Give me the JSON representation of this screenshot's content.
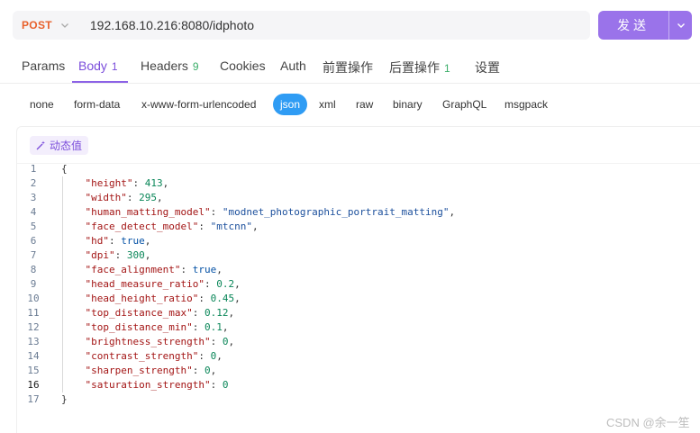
{
  "request": {
    "method": "POST",
    "url": "192.168.10.216:8080/idphoto",
    "send_label": "发送"
  },
  "tabs": [
    {
      "label": "Params",
      "badge": ""
    },
    {
      "label": "Body",
      "badge": "1"
    },
    {
      "label": "Headers",
      "badge": "9"
    },
    {
      "label": "Cookies",
      "badge": ""
    },
    {
      "label": "Auth",
      "badge": ""
    },
    {
      "label": "前置操作",
      "badge": ""
    },
    {
      "label": "后置操作",
      "badge": "1"
    },
    {
      "label": "设置",
      "badge": ""
    }
  ],
  "active_tab": "Body",
  "body_types": [
    "none",
    "form-data",
    "x-www-form-urlencoded",
    "json",
    "xml",
    "raw",
    "binary",
    "GraphQL",
    "msgpack"
  ],
  "active_body_type": "json",
  "dynamic_value_label": "动态值",
  "editor": {
    "line_numbers": [
      "1",
      "2",
      "3",
      "4",
      "5",
      "6",
      "7",
      "8",
      "9",
      "10",
      "11",
      "12",
      "13",
      "14",
      "15",
      "16",
      "17"
    ],
    "open_brace": "{",
    "close_brace": "}",
    "fields": [
      {
        "key": "\"height\"",
        "value": "413",
        "type": "number",
        "comma": ","
      },
      {
        "key": "\"width\"",
        "value": "295",
        "type": "number",
        "comma": ","
      },
      {
        "key": "\"human_matting_model\"",
        "value": "\"modnet_photographic_portrait_matting\"",
        "type": "string",
        "comma": ","
      },
      {
        "key": "\"face_detect_model\"",
        "value": "\"mtcnn\"",
        "type": "string",
        "comma": ","
      },
      {
        "key": "\"hd\"",
        "value": "true",
        "type": "bool",
        "comma": ","
      },
      {
        "key": "\"dpi\"",
        "value": "300",
        "type": "number",
        "comma": ","
      },
      {
        "key": "\"face_alignment\"",
        "value": "true",
        "type": "bool",
        "comma": ","
      },
      {
        "key": "\"head_measure_ratio\"",
        "value": "0.2",
        "type": "number",
        "comma": ","
      },
      {
        "key": "\"head_height_ratio\"",
        "value": "0.45",
        "type": "number",
        "comma": ","
      },
      {
        "key": "\"top_distance_max\"",
        "value": "0.12",
        "type": "number",
        "comma": ","
      },
      {
        "key": "\"top_distance_min\"",
        "value": "0.1",
        "type": "number",
        "comma": ","
      },
      {
        "key": "\"brightness_strength\"",
        "value": "0",
        "type": "number",
        "comma": ","
      },
      {
        "key": "\"contrast_strength\"",
        "value": "0",
        "type": "number",
        "comma": ","
      },
      {
        "key": "\"sharpen_strength\"",
        "value": "0",
        "type": "number",
        "comma": ","
      },
      {
        "key": "\"saturation_strength\"",
        "value": "0",
        "type": "number",
        "comma": ""
      }
    ]
  },
  "watermark": "CSDN @余一笙",
  "colors": {
    "accent": "#9a73ea",
    "method": "#e8612c",
    "json_active": "#2f9cf4",
    "badge_green": "#3cae6a"
  }
}
